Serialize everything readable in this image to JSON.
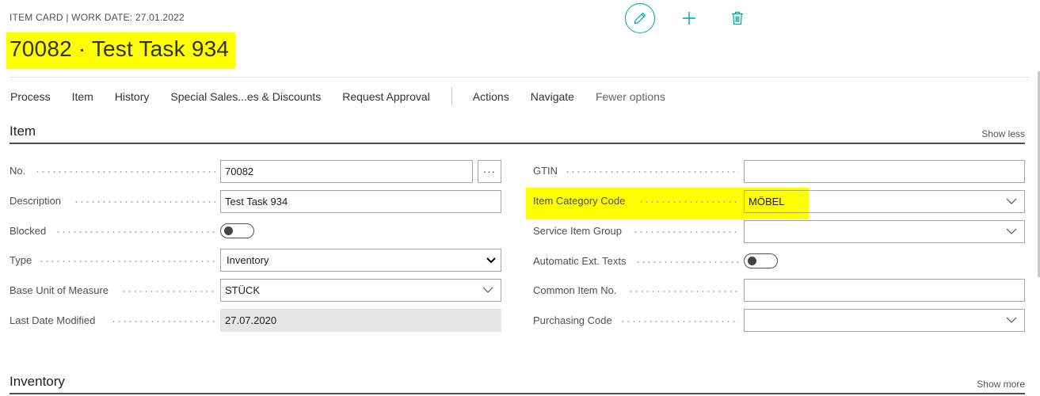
{
  "header": {
    "caption": "ITEM CARD | WORK DATE: 27.01.2022",
    "title": "70082 · Test Task 934"
  },
  "top_actions": [
    "pencil-icon",
    "plus-icon",
    "trash-icon"
  ],
  "menu": {
    "items": [
      "Process",
      "Item",
      "History",
      "Special Sales...es & Discounts",
      "Request Approval"
    ],
    "items_after_sep": [
      "Actions",
      "Navigate"
    ],
    "fewer": "Fewer options"
  },
  "section_item": {
    "title": "Item",
    "toggle_link": "Show less"
  },
  "fields_left": {
    "no": {
      "label": "No.",
      "value": "70082",
      "ellipsis": "···"
    },
    "description": {
      "label": "Description",
      "value": "Test Task 934"
    },
    "blocked": {
      "label": "Blocked",
      "checked": false
    },
    "type": {
      "label": "Type",
      "value": "Inventory"
    },
    "base_uom": {
      "label": "Base Unit of Measure",
      "value": "STÜCK"
    },
    "last_modified": {
      "label": "Last Date Modified",
      "value": "27.07.2020"
    }
  },
  "fields_right": {
    "gtin": {
      "label": "GTIN",
      "value": ""
    },
    "item_category": {
      "label": "Item Category Code",
      "value": "MÖBEL"
    },
    "service_group": {
      "label": "Service Item Group",
      "value": ""
    },
    "auto_ext_texts": {
      "label": "Automatic Ext. Texts",
      "checked": false
    },
    "common_item_no": {
      "label": "Common Item No.",
      "value": ""
    },
    "purchasing_code": {
      "label": "Purchasing Code",
      "value": ""
    }
  },
  "section_inventory": {
    "title": "Inventory",
    "toggle_link": "Show more"
  },
  "colors": {
    "accent": "#00a2a2",
    "highlight": "#ffff00"
  }
}
